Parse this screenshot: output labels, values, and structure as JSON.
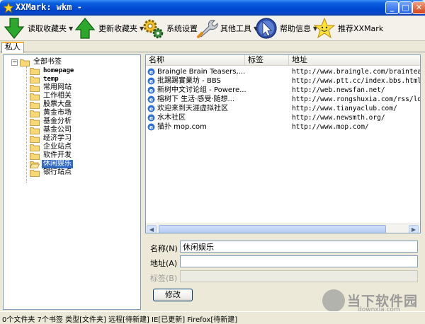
{
  "window": {
    "title": "XXMark: wkm -",
    "controls": {
      "minimize": "_",
      "maximize": "□",
      "close": "✕"
    }
  },
  "toolbar": {
    "items": [
      {
        "label": "读取收藏夹",
        "icon": "download-arrow-icon",
        "dropdown": true
      },
      {
        "label": "更新收藏夹",
        "icon": "upload-arrow-icon",
        "dropdown": true
      },
      {
        "label": "系统设置",
        "icon": "gears-icon",
        "dropdown": false
      },
      {
        "label": "其他工具",
        "icon": "wrench-icon",
        "dropdown": true
      },
      {
        "label": "帮助信息",
        "icon": "help-cursor-icon",
        "dropdown": true
      },
      {
        "label": "推荐XXMark",
        "icon": "smiley-star-icon",
        "dropdown": false
      }
    ],
    "dropdown_glyph": "▼"
  },
  "tabs": [
    {
      "label": "私人",
      "active": true
    }
  ],
  "tree": {
    "expander": "−",
    "root": "全部书签",
    "items": [
      {
        "label": "homepage"
      },
      {
        "label": "temp"
      },
      {
        "label": "常用网站"
      },
      {
        "label": "工作相关"
      },
      {
        "label": "股票大盘"
      },
      {
        "label": "黄金市场"
      },
      {
        "label": "基金分析"
      },
      {
        "label": "基金公司"
      },
      {
        "label": "经济学习"
      },
      {
        "label": "企业站点"
      },
      {
        "label": "软件开发"
      },
      {
        "label": "休闲娱乐",
        "selected": true
      },
      {
        "label": "银行站点"
      }
    ]
  },
  "bookmarks": {
    "columns": {
      "name": "名称",
      "tag": "标签",
      "url": "地址"
    },
    "rows": [
      {
        "name": "Braingle Brain Teasers,...",
        "tag": "",
        "url": "http://www.braingle.com/brainteasers/i"
      },
      {
        "name": "批踢踢實業坊 - BBS",
        "tag": "",
        "url": "http://www.ptt.cc/index.bbs.html"
      },
      {
        "name": "新树中文讨论组 - Powere...",
        "tag": "",
        "url": "http://web.newsfan.net/"
      },
      {
        "name": "榕树下 生活·感受·随想...",
        "tag": "",
        "url": "http://www.rongshuxia.com/rss/ld_index"
      },
      {
        "name": "欢迎来到天涯虚拟社区",
        "tag": "",
        "url": "http://www.tianyaclub.com/"
      },
      {
        "name": "水木社区",
        "tag": "",
        "url": "http://www.newsmth.org/"
      },
      {
        "name": "猫扑 mop.com",
        "tag": "",
        "url": "http://www.mop.com/"
      }
    ],
    "scroll": {
      "left": "◀",
      "right": "▶"
    }
  },
  "editor": {
    "name_label": "名称(N)",
    "name_value": "休闲娱乐",
    "url_label": "地址(A)",
    "url_value": "",
    "tag_label": "标签(B)",
    "tag_value": "",
    "modify_button": "修改"
  },
  "statusbar": {
    "text": "0个文件夹 7个书签  类型[文件夹] 远程[待新建] IE[已更新] Firefox[待新建]"
  },
  "watermark": {
    "text": "当下软件园",
    "sub": "downxia.com"
  }
}
